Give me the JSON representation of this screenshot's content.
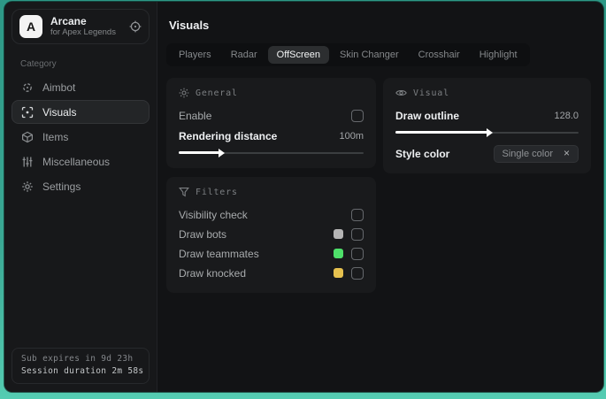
{
  "colors": {
    "desktop_teal_top": "#2d9886",
    "desktop_teal_bottom": "#55ccb2",
    "window_bg": "#121315",
    "sidebar_bg": "#17181a",
    "panel_bg": "#191a1c",
    "swatch_gray": "#b5b5b5",
    "swatch_green": "#4ee06a",
    "swatch_yellow": "#e6c14f"
  },
  "icons": {
    "scope-icon": "circular crosshair",
    "crosshair-icon": "aim crosshair",
    "focus-icon": "scan frame with dot",
    "box-icon": "3d cube",
    "sliders-icon": "vertical sliders",
    "gear-icon": "gear",
    "sun-icon": "sun rays",
    "funnel-icon": "filter funnel",
    "eye-icon": "eye",
    "close_glyph": "×"
  },
  "app": {
    "logo_letter": "A",
    "title": "Arcane",
    "subtitle": "for Apex Legends"
  },
  "sidebar": {
    "category_label": "Category",
    "items": [
      {
        "label": "Aimbot",
        "selected": false
      },
      {
        "label": "Visuals",
        "selected": true
      },
      {
        "label": "Items",
        "selected": false
      },
      {
        "label": "Miscellaneous",
        "selected": false
      },
      {
        "label": "Settings",
        "selected": false
      }
    ],
    "footer": {
      "sub_expires": "Sub expires in 9d 23h",
      "session_duration": "Session duration 2m 58s"
    }
  },
  "main": {
    "title": "Visuals",
    "tabs": [
      {
        "label": "Players",
        "selected": false
      },
      {
        "label": "Radar",
        "selected": false
      },
      {
        "label": "OffScreen",
        "selected": true
      },
      {
        "label": "Skin Changer",
        "selected": false
      },
      {
        "label": "Crosshair",
        "selected": false
      },
      {
        "label": "Highlight",
        "selected": false
      }
    ],
    "panels": {
      "general": {
        "title": "General",
        "enable_label": "Enable",
        "enable_checked": false,
        "rendering_distance_label": "Rendering distance",
        "rendering_distance_value": "100m",
        "slider_percent": 22,
        "slider_fill_style": "width:22%"
      },
      "filters": {
        "title": "Filters",
        "rows": [
          {
            "label": "Visibility check",
            "checked": false
          },
          {
            "label": "Draw bots",
            "swatch": "#b5b5b5",
            "swatch_style": "background:#b5b5b5",
            "checked": false
          },
          {
            "label": "Draw teammates",
            "swatch": "#4ee06a",
            "swatch_style": "background:#4ee06a",
            "checked": false
          },
          {
            "label": "Draw knocked",
            "swatch": "#e6c14f",
            "swatch_style": "background:#e6c14f",
            "checked": false
          }
        ]
      },
      "visual": {
        "title": "Visual",
        "draw_outline_label": "Draw outline",
        "draw_outline_value": "128.0",
        "slider_percent": 50,
        "slider_fill_style": "width:50%",
        "style_color_label": "Style color",
        "style_color_value": "Single color",
        "chip_close_glyph": "×"
      }
    }
  }
}
